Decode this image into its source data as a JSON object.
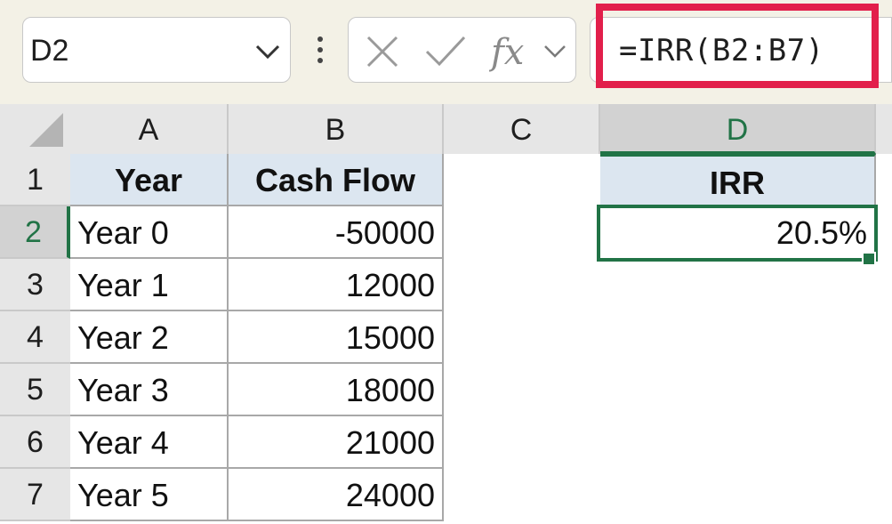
{
  "name_box": {
    "value": "D2"
  },
  "formula_bar": {
    "formula": "=IRR(B2:B7)",
    "cancel_icon": "close-icon",
    "enter_icon": "checkmark-icon",
    "function_icon": "fx-icon"
  },
  "columns": [
    "A",
    "B",
    "C",
    "D"
  ],
  "selected_column": "D",
  "rows": [
    "1",
    "2",
    "3",
    "4",
    "5",
    "6",
    "7"
  ],
  "selected_row": "2",
  "table": {
    "headers": [
      "Year",
      "Cash Flow"
    ],
    "rows": [
      [
        "Year 0",
        "-50000"
      ],
      [
        "Year 1",
        "12000"
      ],
      [
        "Year 2",
        "15000"
      ],
      [
        "Year 3",
        "18000"
      ],
      [
        "Year 4",
        "21000"
      ],
      [
        "Year 5",
        "24000"
      ]
    ]
  },
  "irr": {
    "label": "IRR",
    "value": "20.5%"
  },
  "colors": {
    "highlight": "#e21f4b",
    "selection": "#217346",
    "header_fill": "#dce6f0"
  }
}
